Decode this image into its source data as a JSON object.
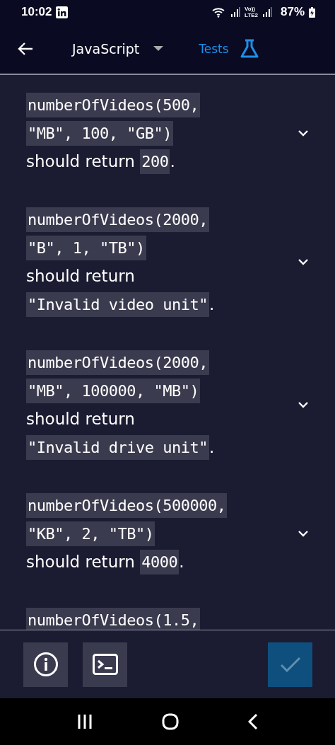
{
  "status_bar": {
    "time": "10:02",
    "network_top": "Vo))",
    "network_bottom": "LTE2",
    "battery": "87%"
  },
  "header": {
    "language": "JavaScript",
    "tests_label": "Tests"
  },
  "tests": [
    {
      "lines": [
        [
          {
            "kind": "code",
            "text": "numberOfVideos(500,"
          }
        ],
        [
          {
            "kind": "code",
            "text": "\"MB\", 100, \"GB\")"
          }
        ],
        [
          {
            "kind": "text",
            "text": "should return "
          },
          {
            "kind": "code",
            "text": "200"
          },
          {
            "kind": "text",
            "text": "."
          }
        ]
      ]
    },
    {
      "lines": [
        [
          {
            "kind": "code",
            "text": "numberOfVideos(2000,"
          }
        ],
        [
          {
            "kind": "code",
            "text": "\"B\", 1, \"TB\")"
          }
        ],
        [
          {
            "kind": "text",
            "text": "should return"
          }
        ],
        [
          {
            "kind": "code",
            "text": "\"Invalid video unit\""
          },
          {
            "kind": "text",
            "text": "."
          }
        ]
      ]
    },
    {
      "lines": [
        [
          {
            "kind": "code",
            "text": "numberOfVideos(2000,"
          }
        ],
        [
          {
            "kind": "code",
            "text": "\"MB\", 100000, \"MB\")"
          }
        ],
        [
          {
            "kind": "text",
            "text": "should return"
          }
        ],
        [
          {
            "kind": "code",
            "text": "\"Invalid drive unit\""
          },
          {
            "kind": "text",
            "text": "."
          }
        ]
      ]
    },
    {
      "lines": [
        [
          {
            "kind": "code",
            "text": "numberOfVideos(500000,"
          }
        ],
        [
          {
            "kind": "code",
            "text": "\"KB\", 2, \"TB\")"
          }
        ],
        [
          {
            "kind": "text",
            "text": "should return "
          },
          {
            "kind": "code",
            "text": "4000"
          },
          {
            "kind": "text",
            "text": "."
          }
        ]
      ]
    },
    {
      "lines": [
        [
          {
            "kind": "code",
            "text": "numberOfVideos(1.5,"
          }
        ]
      ]
    }
  ]
}
